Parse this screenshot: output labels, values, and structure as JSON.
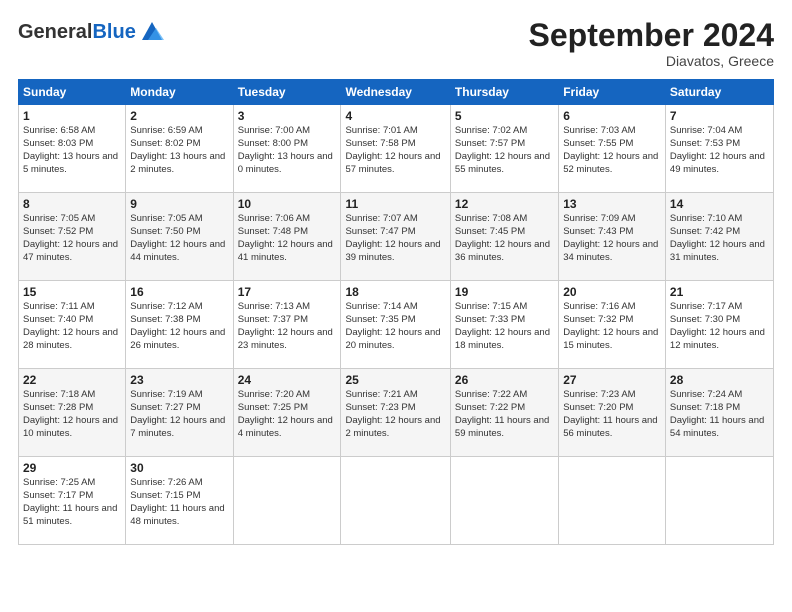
{
  "logo": {
    "general": "General",
    "blue": "Blue"
  },
  "header": {
    "month": "September 2024",
    "location": "Diavatos, Greece"
  },
  "weekdays": [
    "Sunday",
    "Monday",
    "Tuesday",
    "Wednesday",
    "Thursday",
    "Friday",
    "Saturday"
  ],
  "weeks": [
    [
      {
        "day": "1",
        "sunrise": "6:58 AM",
        "sunset": "8:03 PM",
        "daylight": "13 hours and 5 minutes."
      },
      {
        "day": "2",
        "sunrise": "6:59 AM",
        "sunset": "8:02 PM",
        "daylight": "13 hours and 2 minutes."
      },
      {
        "day": "3",
        "sunrise": "7:00 AM",
        "sunset": "8:00 PM",
        "daylight": "13 hours and 0 minutes."
      },
      {
        "day": "4",
        "sunrise": "7:01 AM",
        "sunset": "7:58 PM",
        "daylight": "12 hours and 57 minutes."
      },
      {
        "day": "5",
        "sunrise": "7:02 AM",
        "sunset": "7:57 PM",
        "daylight": "12 hours and 55 minutes."
      },
      {
        "day": "6",
        "sunrise": "7:03 AM",
        "sunset": "7:55 PM",
        "daylight": "12 hours and 52 minutes."
      },
      {
        "day": "7",
        "sunrise": "7:04 AM",
        "sunset": "7:53 PM",
        "daylight": "12 hours and 49 minutes."
      }
    ],
    [
      {
        "day": "8",
        "sunrise": "7:05 AM",
        "sunset": "7:52 PM",
        "daylight": "12 hours and 47 minutes."
      },
      {
        "day": "9",
        "sunrise": "7:05 AM",
        "sunset": "7:50 PM",
        "daylight": "12 hours and 44 minutes."
      },
      {
        "day": "10",
        "sunrise": "7:06 AM",
        "sunset": "7:48 PM",
        "daylight": "12 hours and 41 minutes."
      },
      {
        "day": "11",
        "sunrise": "7:07 AM",
        "sunset": "7:47 PM",
        "daylight": "12 hours and 39 minutes."
      },
      {
        "day": "12",
        "sunrise": "7:08 AM",
        "sunset": "7:45 PM",
        "daylight": "12 hours and 36 minutes."
      },
      {
        "day": "13",
        "sunrise": "7:09 AM",
        "sunset": "7:43 PM",
        "daylight": "12 hours and 34 minutes."
      },
      {
        "day": "14",
        "sunrise": "7:10 AM",
        "sunset": "7:42 PM",
        "daylight": "12 hours and 31 minutes."
      }
    ],
    [
      {
        "day": "15",
        "sunrise": "7:11 AM",
        "sunset": "7:40 PM",
        "daylight": "12 hours and 28 minutes."
      },
      {
        "day": "16",
        "sunrise": "7:12 AM",
        "sunset": "7:38 PM",
        "daylight": "12 hours and 26 minutes."
      },
      {
        "day": "17",
        "sunrise": "7:13 AM",
        "sunset": "7:37 PM",
        "daylight": "12 hours and 23 minutes."
      },
      {
        "day": "18",
        "sunrise": "7:14 AM",
        "sunset": "7:35 PM",
        "daylight": "12 hours and 20 minutes."
      },
      {
        "day": "19",
        "sunrise": "7:15 AM",
        "sunset": "7:33 PM",
        "daylight": "12 hours and 18 minutes."
      },
      {
        "day": "20",
        "sunrise": "7:16 AM",
        "sunset": "7:32 PM",
        "daylight": "12 hours and 15 minutes."
      },
      {
        "day": "21",
        "sunrise": "7:17 AM",
        "sunset": "7:30 PM",
        "daylight": "12 hours and 12 minutes."
      }
    ],
    [
      {
        "day": "22",
        "sunrise": "7:18 AM",
        "sunset": "7:28 PM",
        "daylight": "12 hours and 10 minutes."
      },
      {
        "day": "23",
        "sunrise": "7:19 AM",
        "sunset": "7:27 PM",
        "daylight": "12 hours and 7 minutes."
      },
      {
        "day": "24",
        "sunrise": "7:20 AM",
        "sunset": "7:25 PM",
        "daylight": "12 hours and 4 minutes."
      },
      {
        "day": "25",
        "sunrise": "7:21 AM",
        "sunset": "7:23 PM",
        "daylight": "12 hours and 2 minutes."
      },
      {
        "day": "26",
        "sunrise": "7:22 AM",
        "sunset": "7:22 PM",
        "daylight": "11 hours and 59 minutes."
      },
      {
        "day": "27",
        "sunrise": "7:23 AM",
        "sunset": "7:20 PM",
        "daylight": "11 hours and 56 minutes."
      },
      {
        "day": "28",
        "sunrise": "7:24 AM",
        "sunset": "7:18 PM",
        "daylight": "11 hours and 54 minutes."
      }
    ],
    [
      {
        "day": "29",
        "sunrise": "7:25 AM",
        "sunset": "7:17 PM",
        "daylight": "11 hours and 51 minutes."
      },
      {
        "day": "30",
        "sunrise": "7:26 AM",
        "sunset": "7:15 PM",
        "daylight": "11 hours and 48 minutes."
      },
      null,
      null,
      null,
      null,
      null
    ]
  ]
}
